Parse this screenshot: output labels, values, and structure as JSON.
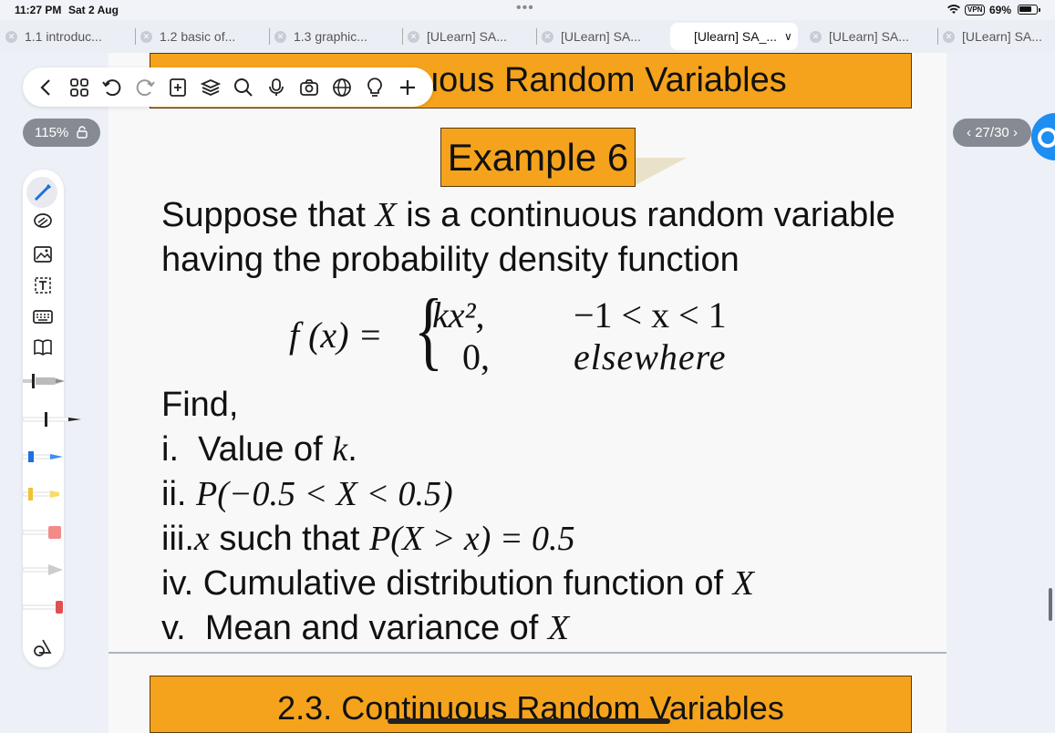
{
  "status": {
    "time": "11:27 PM",
    "date": "Sat 2 Aug",
    "vpn": "VPN",
    "battery": "69%"
  },
  "tabs": [
    {
      "label": "1.1 introduc...",
      "active": false
    },
    {
      "label": "1.2 basic of...",
      "active": false
    },
    {
      "label": "1.3 graphic...",
      "active": false
    },
    {
      "label": "[ULearn] SA...",
      "active": false
    },
    {
      "label": "[ULearn] SA...",
      "active": false
    },
    {
      "label": "[Ulearn] SA_...",
      "active": true
    },
    {
      "label": "[ULearn] SA...",
      "active": false
    },
    {
      "label": "[ULearn] SA...",
      "active": false
    }
  ],
  "viewer": {
    "zoom": "115%",
    "page_indicator": "27/30",
    "toolbar_icons": [
      "back-icon",
      "grid-icon",
      "undo-icon",
      "redo-icon",
      "add-page-icon",
      "layers-icon",
      "search-icon",
      "microphone-icon",
      "camera-icon",
      "globe-icon",
      "bulb-icon",
      "plus-icon"
    ]
  },
  "slide": {
    "section_title": "2.3. Continuous Random Variables",
    "top_banner_visible": "uous Random Variables",
    "example_title": "Example 6",
    "intro_line1_a": "Suppose that ",
    "intro_var": "X",
    "intro_line1_b": " is a continuous random variable",
    "intro_line2": "having the probability density function",
    "pdf": {
      "lhs": "f (x) =",
      "case1_expr": "kx², ",
      "case1_range": "−1 < x < 1",
      "case2_expr": "0,",
      "case2_range": "elsewhere"
    },
    "find_label": "Find,",
    "items": [
      {
        "num": "i.",
        "text": "Value of ",
        "math": "k",
        "tail": "."
      },
      {
        "num": "ii.",
        "text": "",
        "math": "P(−0.5 < X < 0.5)",
        "tail": ""
      },
      {
        "num": "iii.",
        "text": " such that ",
        "math_pre": "x",
        "math": "P(X > x) = 0.5",
        "tail": ""
      },
      {
        "num": "iv.",
        "text": "Cumulative distribution function of ",
        "math": "X",
        "tail": ""
      },
      {
        "num": "v.",
        "text": "Mean and variance of ",
        "math": "X",
        "tail": ""
      }
    ]
  },
  "colors": {
    "banner": "#f5a31c",
    "accent_blue": "#1e8ef0",
    "pill_grey": "#868b93"
  }
}
